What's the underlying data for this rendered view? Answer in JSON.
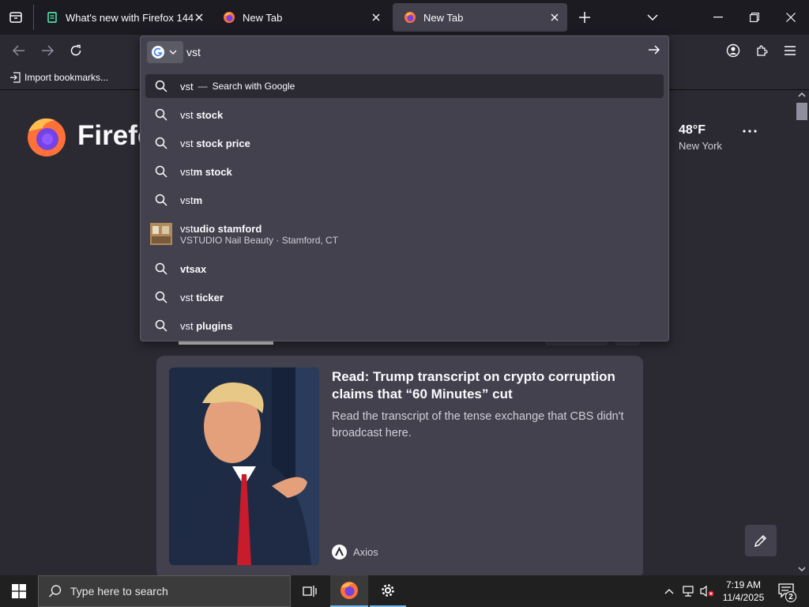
{
  "tabs": [
    {
      "title": "What's new with Firefox 144",
      "active": false
    },
    {
      "title": "New Tab",
      "active": false
    },
    {
      "title": "New Tab",
      "active": true
    }
  ],
  "bookmarks": {
    "import_label": "Import bookmarks..."
  },
  "urlbar": {
    "typed": "vst",
    "suggestions": [
      {
        "typed": "vst",
        "rest": "",
        "hint": "Search with Google",
        "kind": "search",
        "selected": true
      },
      {
        "typed": "vst",
        "rest": " stock",
        "kind": "search"
      },
      {
        "typed": "vst",
        "rest": " stock price",
        "kind": "search"
      },
      {
        "typed": "vst",
        "rest": "m stock",
        "kind": "search"
      },
      {
        "typed": "vst",
        "rest": "m",
        "kind": "search"
      },
      {
        "typed": "vst",
        "rest": "udio stamford",
        "sub": "VSTUDIO Nail Beauty · Stamford, CT",
        "kind": "place"
      },
      {
        "typed": "",
        "rest": "vtsax",
        "kind": "search"
      },
      {
        "typed": "vst",
        "rest": " ticker",
        "kind": "search"
      },
      {
        "typed": "vst",
        "rest": " plugins",
        "kind": "search"
      }
    ]
  },
  "newtab": {
    "logo_text": "Firefox",
    "weather": {
      "temp": "48°F",
      "city": "New York"
    },
    "story": {
      "title": "Read: Trump transcript on crypto corruption claims that “60 Minutes” cut",
      "excerpt": "Read the transcript of the tense exchange that CBS didn't broadcast here.",
      "source": "Axios"
    }
  },
  "taskbar": {
    "search_placeholder": "Type here to search",
    "time": "7:19 AM",
    "date": "11/4/2025",
    "notification_count": "2"
  },
  "colors": {
    "accent": "#ff7139",
    "panel": "#42414d",
    "toolbar": "#2b2a33"
  }
}
